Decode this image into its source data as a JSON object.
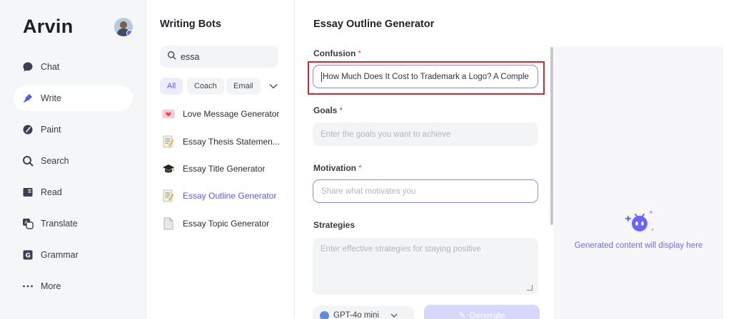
{
  "brand": "Arvin",
  "nav": {
    "items": [
      {
        "label": "Chat",
        "icon": "chat-icon"
      },
      {
        "label": "Write",
        "icon": "pen-icon",
        "active": true
      },
      {
        "label": "Paint",
        "icon": "palette-icon"
      },
      {
        "label": "Search",
        "icon": "search-icon"
      },
      {
        "label": "Read",
        "icon": "book-icon"
      },
      {
        "label": "Translate",
        "icon": "translate-icon"
      },
      {
        "label": "Grammar",
        "icon": "grammar-icon"
      },
      {
        "label": "More",
        "icon": "more-dots-icon"
      }
    ]
  },
  "bots": {
    "title": "Writing Bots",
    "search_value": "essa",
    "filters": [
      "All",
      "Coach",
      "Email"
    ],
    "active_filter": "All",
    "items": [
      {
        "label": "Love Message Generator",
        "icon": "love-letter-icon"
      },
      {
        "label": "Essay Thesis Statemen...",
        "icon": "memo-icon"
      },
      {
        "label": "Essay Title Generator",
        "icon": "graduation-cap-icon"
      },
      {
        "label": "Essay Outline Generator",
        "icon": "memo-icon",
        "active": true
      },
      {
        "label": "Essay Topic Generator",
        "icon": "page-icon"
      }
    ]
  },
  "form": {
    "title": "Essay Outline Generator",
    "fields": {
      "confusion": {
        "label": "Confusion",
        "required": true,
        "value": "How Much Does It Cost to Trademark a Logo? A Comple"
      },
      "goals": {
        "label": "Goals",
        "required": true,
        "placeholder": "Enter the goals you want to achieve"
      },
      "motivation": {
        "label": "Motivation",
        "required": true,
        "placeholder": "Share what motivates you"
      },
      "strategies": {
        "label": "Strategies",
        "required": false,
        "placeholder": "Enter effective strategies for staying positive"
      }
    },
    "model": "GPT-4o mini",
    "generate_label": "Generate"
  },
  "output": {
    "placeholder": "Generated content will display here"
  },
  "colors": {
    "accent": "#5b58e8",
    "highlight_box": "#d0282e",
    "required_star": "#e0435b"
  }
}
